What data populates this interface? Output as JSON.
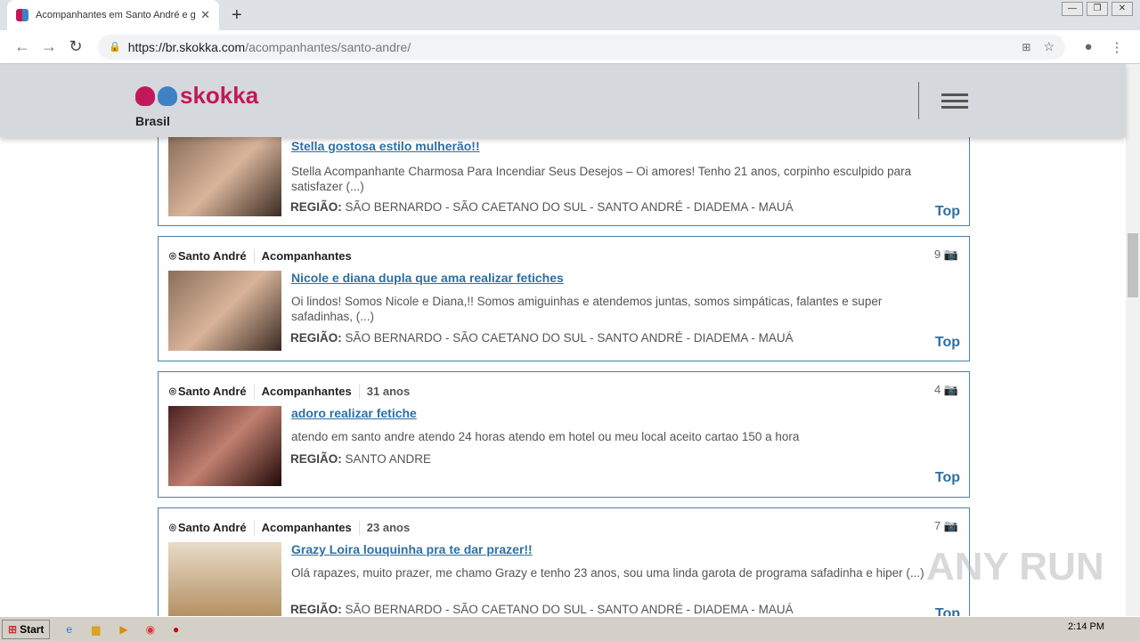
{
  "browser": {
    "tab_title": "Acompanhantes em Santo André e g",
    "url_domain": "https://br.skokka.com",
    "url_path": "/acompanhantes/santo-andre/"
  },
  "site": {
    "logo": "skokka",
    "country": "Brasil",
    "brand_colors": {
      "pink": "#c2185b",
      "blue": "#3f82c4"
    }
  },
  "listings": [
    {
      "city": "",
      "category": "",
      "age": "",
      "photos": "",
      "title": "Stella gostosa estilo mulherão!!",
      "desc": "Stella Acompanhante Charmosa Para Incendiar Seus Desejos – Oi amores! Tenho 21 anos, corpinho esculpido para satisfazer (...)",
      "region_label": "REGIÃO:",
      "region": "SÃO BERNARDO - SÃO CAETANO DO SUL - SANTO ANDRÉ - DIADEMA - MAUÁ",
      "badge": "Top"
    },
    {
      "city": "Santo André",
      "category": "Acompanhantes",
      "age": "",
      "photos": "9",
      "title": "Nicole e diana dupla que ama realizar fetiches",
      "desc": "Oi lindos! Somos Nicole e Diana,!! Somos amiguinhas e atendemos juntas, somos simpáticas, falantes e super safadinhas, (...)",
      "region_label": "REGIÃO:",
      "region": "SÃO BERNARDO - SÃO CAETANO DO SUL - SANTO ANDRÉ - DIADEMA - MAUÁ",
      "badge": "Top"
    },
    {
      "city": "Santo André",
      "category": "Acompanhantes",
      "age": "31 anos",
      "photos": "4",
      "title": "adoro realizar fetiche",
      "desc": "atendo em santo andre atendo 24 horas atendo em hotel ou meu local aceito cartao 150 a hora",
      "region_label": "REGIÃO:",
      "region": "SANTO ANDRE",
      "badge": "Top"
    },
    {
      "city": "Santo André",
      "category": "Acompanhantes",
      "age": "23 anos",
      "photos": "7",
      "title": "Grazy Loira louquinha pra te dar prazer!!",
      "desc": "Olá rapazes, muito prazer, me chamo Grazy e tenho 23 anos, sou uma linda garota de programa safadinha e hiper (...)",
      "region_label": "REGIÃO:",
      "region": "SÃO BERNARDO - SÃO CAETANO DO SUL - SANTO ANDRÉ - DIADEMA - MAUÁ",
      "badge": "Top"
    }
  ],
  "taskbar": {
    "start": "Start",
    "time": "2:14 PM"
  },
  "watermark": "ANY RUN"
}
